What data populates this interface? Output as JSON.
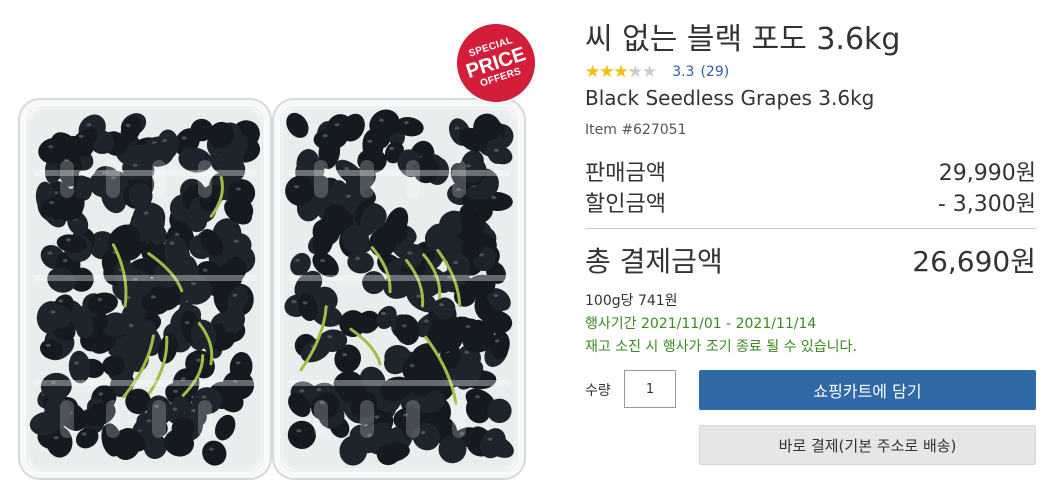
{
  "badge": {
    "line1": "SPECIAL",
    "line2": "PRICE",
    "line3": "OFFERS",
    "color": "#d31e3a"
  },
  "product": {
    "title": "씨 없는 블랙 포도 3.6kg",
    "rating_fraction": 0.66,
    "rating_value": "3.3",
    "rating_count": "(29)",
    "english_name": "Black Seedless Grapes 3.6kg",
    "item_number": "Item #627051"
  },
  "pricing": {
    "sale_label": "판매금액",
    "sale_value": "29,990원",
    "discount_label": "할인금액",
    "discount_value": "- 3,300원",
    "total_label": "총 결제금액",
    "total_value": "26,690원",
    "unit_price": "100g당 741원",
    "event_period": "행사기간 2021/11/01 - 2021/11/14",
    "event_note": "재고 소진 시 행사가 조기 종료 될 수 있습니다."
  },
  "purchase": {
    "qty_label": "수량",
    "qty_value": "1",
    "cart_button": "쇼핑카트에 담기",
    "buy_button": "바로 결제(기본 주소로 배송)"
  },
  "colors": {
    "accent_blue": "#2f6aa6",
    "event_green": "#3a8a1d",
    "star_gold": "#f2c200",
    "badge_red": "#d31e3a"
  },
  "icons": {
    "rating": "star-rating-icon"
  }
}
